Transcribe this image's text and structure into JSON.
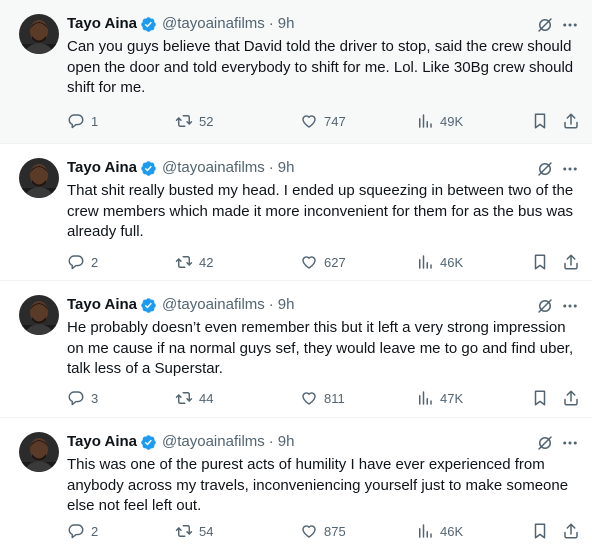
{
  "tweets": [
    {
      "author": {
        "name": "Tayo Aina",
        "handle": "@tayoainafilms",
        "time": "9h"
      },
      "text": "Can you guys believe that David told the driver to stop, said the crew should open the door and told everybody to shift for me. Lol. Like 30Bg crew should shift for me.",
      "stats": {
        "replies": "1",
        "reposts": "52",
        "likes": "747",
        "views": "49K"
      }
    },
    {
      "author": {
        "name": "Tayo Aina",
        "handle": "@tayoainafilms",
        "time": "9h"
      },
      "text": "That shit really busted my head. I ended up squeezing in between two of the crew members which made it more inconvenient for them for as the bus was already full.",
      "stats": {
        "replies": "2",
        "reposts": "42",
        "likes": "627",
        "views": "46K"
      }
    },
    {
      "author": {
        "name": "Tayo Aina",
        "handle": "@tayoainafilms",
        "time": "9h"
      },
      "text": "He probably doesn’t even remember this but it left a very strong impression on me cause if na normal guys sef, they would leave me to go and find uber, talk less of a Superstar.",
      "stats": {
        "replies": "3",
        "reposts": "44",
        "likes": "811",
        "views": "47K"
      }
    },
    {
      "author": {
        "name": "Tayo Aina",
        "handle": "@tayoainafilms",
        "time": "9h"
      },
      "text": "This was one of the purest acts of humility I have ever experienced from anybody across my travels, inconveniencing yourself just to make someone else not feel left out.",
      "stats": {
        "replies": "2",
        "reposts": "54",
        "likes": "875",
        "views": "46K"
      }
    }
  ],
  "separator": "·",
  "icons": {
    "verified": "verified-badge-icon",
    "grok": "grok-icon",
    "more": "more-icon",
    "reply": "reply-icon",
    "repost": "repost-icon",
    "like": "heart-icon",
    "views": "views-icon",
    "bookmark": "bookmark-icon",
    "share": "share-icon"
  },
  "colors": {
    "text": "#0f1419",
    "secondary": "#536471",
    "verified": "#1d9bf0",
    "highlight_bg": "#f7f9f9",
    "divider": "#eff3f4"
  }
}
